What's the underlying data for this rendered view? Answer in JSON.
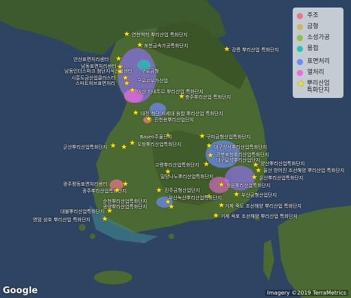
{
  "legend": {
    "items": [
      {
        "label": "주조",
        "color": "#e8758a"
      },
      {
        "label": "금형",
        "color": "#c8b86a"
      },
      {
        "label": "소성가공",
        "color": "#8fbf44"
      },
      {
        "label": "용접",
        "color": "#22c4b4"
      },
      {
        "label": "표면처리",
        "color": "#6e8cff"
      },
      {
        "label": "열처리",
        "color": "#f06ae0"
      }
    ],
    "star_label_line1": "뿌리산업",
    "star_label_line2": "특화단지",
    "star_color": "#ffe600"
  },
  "labels": [
    "연천백학 뿌리산업 특화단지",
    "포천금속가공특화단지",
    "강릉 뿌리산업 특화단지",
    "안산표면처리센터",
    "남동표면처리센터",
    "남동인더스파크 첨단지식산업센터",
    "시흥도금산업클러스터",
    "스마트허브표면처리",
    "구로금형",
    "구로고부가산업",
    "아산 비내뚜르 뿌리산업 특화단지",
    "충주뿌리산업 특화단지",
    "대전 첨단 지세대 융합 뿌리산업 특화단지",
    "진천용뿌리산업단지",
    "구미금형산업특화단지",
    "Baseo주물단지",
    "오창뿌리산업특화단지",
    "군산뿌리산업특화단지",
    "대구성서뿌리산업특화단지",
    "고령뿌리산업특화단지",
    "경북포항뿌리산업특화단지",
    "대구달성뿌리산업단지",
    "양산뿌리산업특화단지",
    "울산 방어진 조선해양 뿌리산업 특화단지",
    "온산뿌리산업특화단지",
    "밀양나노뿌리산업특화단지",
    "광주평동표면처리센터",
    "광주뿌리산업특화단지",
    "진주금형산업단지",
    "창원뿌리산업특화단지",
    "부산녹산뿌리산업특화단지",
    "순천뿌리산업특화단지",
    "광양뿌리산업특화단지",
    "대불뿌리산업특화단지",
    "영암 삼호 뿌리산업 특화단지",
    "거제 죽도 조선해양 뿌리산업 특화단지",
    "거제 옥포 조선해양 뿌리산업 특화단지",
    "부산금형산업단지"
  ],
  "attribution": {
    "logo": "Google",
    "imagery": "Imagery ©2019 TerraMetrics"
  }
}
